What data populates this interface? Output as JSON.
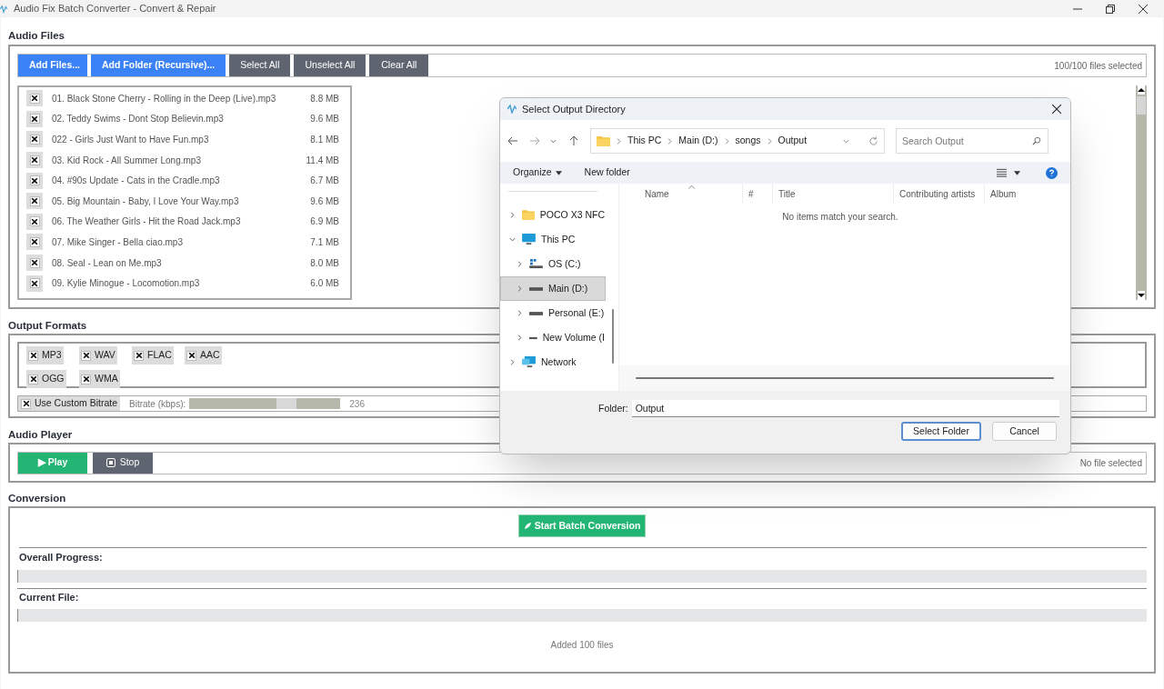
{
  "window": {
    "title": "Audio Fix Batch Converter - Convert & Repair"
  },
  "audio_files": {
    "heading": "Audio Files",
    "buttons": [
      {
        "label": "Add Files...",
        "kind": "primary"
      },
      {
        "label": "Add Folder (Recursive)...",
        "kind": "primary"
      },
      {
        "label": "Select All",
        "kind": "secondary"
      },
      {
        "label": "Unselect All",
        "kind": "secondary"
      },
      {
        "label": "Clear All",
        "kind": "secondary"
      }
    ],
    "selection_count": "100/100 files selected",
    "files": [
      {
        "name": "01. Black Stone Cherry - Rolling in the Deep (Live).mp3",
        "size": "8.8 MB",
        "checked": true
      },
      {
        "name": "02. Teddy Swims - Dont Stop Believin.mp3",
        "size": "9.6 MB",
        "checked": true
      },
      {
        "name": "022 - Girls Just Want to Have Fun.mp3",
        "size": "8.1 MB",
        "checked": true
      },
      {
        "name": "03. Kid Rock - All Summer Long.mp3",
        "size": "11.4 MB",
        "checked": true
      },
      {
        "name": "04. #90s Update - Cats in the Cradle.mp3",
        "size": "6.7 MB",
        "checked": true
      },
      {
        "name": "05. Big Mountain - Baby, I Love Your Way.mp3",
        "size": "9.6 MB",
        "checked": true
      },
      {
        "name": "06. The Weather Girls - Hit the Road Jack.mp3",
        "size": "6.9 MB",
        "checked": true
      },
      {
        "name": "07. Mike Singer - Bella ciao.mp3",
        "size": "7.1 MB",
        "checked": true
      },
      {
        "name": "08. Seal - Lean on Me.mp3",
        "size": "8.0 MB",
        "checked": true
      },
      {
        "name": "09. Kylie Minogue - Locomotion.mp3",
        "size": "6.0 MB",
        "checked": true
      }
    ]
  },
  "output_formats": {
    "heading": "Output Formats",
    "formats": [
      {
        "label": "MP3",
        "checked": true
      },
      {
        "label": "WAV",
        "checked": true
      },
      {
        "label": "FLAC",
        "checked": true
      },
      {
        "label": "AAC",
        "checked": true
      },
      {
        "label": "OGG",
        "checked": true
      },
      {
        "label": "WMA",
        "checked": true
      }
    ],
    "custom_bitrate": {
      "label": "Use Custom Bitrate",
      "checked": true
    },
    "bitrate": {
      "label": "Bitrate (kbps):",
      "level": 0.64,
      "reading": "236"
    }
  },
  "audio_player": {
    "heading": "Audio Player",
    "play_button": "▶ Play",
    "stop_button": "Stop",
    "status": "No file selected"
  },
  "conversion": {
    "heading": "Conversion",
    "start_button": "Start Batch Conversion",
    "overall_progress": {
      "label": "Overall Progress:",
      "level": 0
    },
    "current_file": {
      "label": "Current File:",
      "level": 0
    },
    "status": "Added 100 files"
  },
  "dialog": {
    "title": "Select Output Directory",
    "breadcrumb": [
      "This PC",
      "Main (D:)",
      "songs",
      "Output"
    ],
    "search": {
      "placeholder": "Search Output"
    },
    "toolbar": {
      "organize": "Organize",
      "new_folder": "New folder"
    },
    "nav_items": [
      {
        "label": "POCO X3 NFC",
        "kind": "folder",
        "expanded": false,
        "selected": false
      },
      {
        "label": "This PC",
        "kind": "computer",
        "expanded": true,
        "selected": false,
        "children": [
          {
            "label": "OS (C:)",
            "kind": "system_drive",
            "expanded": false,
            "selected": false
          },
          {
            "label": "Main (D:)",
            "kind": "drive",
            "expanded": false,
            "selected": true
          },
          {
            "label": "Personal (E:)",
            "kind": "drive",
            "expanded": false,
            "selected": false
          },
          {
            "label": "New Volume (I",
            "kind": "drive",
            "expanded": false,
            "selected": false
          }
        ]
      },
      {
        "label": "Network",
        "kind": "network",
        "expanded": false,
        "selected": false
      }
    ],
    "columns": [
      "Name",
      "#",
      "Title",
      "Contributing artists",
      "Album"
    ],
    "empty_message": "No items match your search.",
    "folder_label": "Folder:",
    "folder_value": "Output",
    "buttons": [
      {
        "label": "Select Folder",
        "kind": "default"
      },
      {
        "label": "Cancel",
        "kind": "normal"
      }
    ]
  }
}
